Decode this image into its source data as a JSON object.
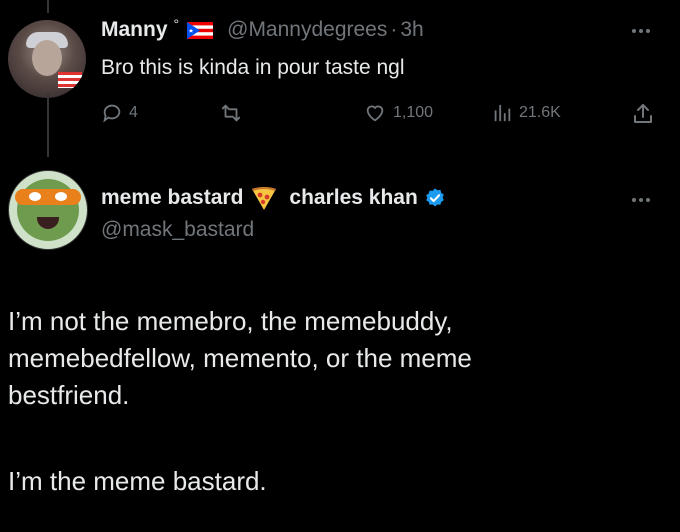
{
  "tweet1": {
    "display_name": "Manny",
    "name_suffix": "°",
    "flag_icon": "puerto-rico-flag-icon",
    "handle": "@Mannydegrees",
    "time": "3h",
    "text": "Bro this is kinda in pour taste ngl",
    "actions": {
      "reply_count": "4",
      "retweet_count": "",
      "like_count": "1,100",
      "view_count": "21.6K"
    }
  },
  "tweet2": {
    "display_name": "meme bastard",
    "secondary_name": "charles khan",
    "handle": "@mask_bastard",
    "paragraphs": [
      "I’m not the memebro, the memebuddy,",
      "memebedfellow, memento, or the meme",
      "bestfriend.",
      "I’m the meme bastard."
    ]
  },
  "colors": {
    "background": "#000000",
    "text": "#e7e9ea",
    "muted": "#71767b",
    "verified": "#1d9bf0"
  }
}
